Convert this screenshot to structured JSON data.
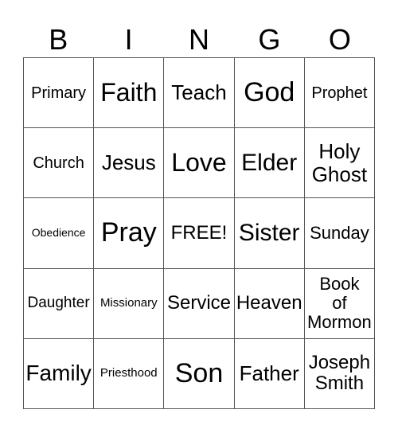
{
  "header": [
    "B",
    "I",
    "N",
    "G",
    "O"
  ],
  "cells": [
    "Primary",
    "Faith",
    "Teach",
    "God",
    "Prophet",
    "Church",
    "Jesus",
    "Love",
    "Elder",
    "Holy\nGhost",
    "Obedience",
    "Pray",
    "FREE!",
    "Sister",
    "Sunday",
    "Daughter",
    "Missionary",
    "Service",
    "Heaven",
    "Book\nof\nMormon",
    "Family",
    "Priesthood",
    "Son",
    "Father",
    "Joseph\nSmith"
  ]
}
